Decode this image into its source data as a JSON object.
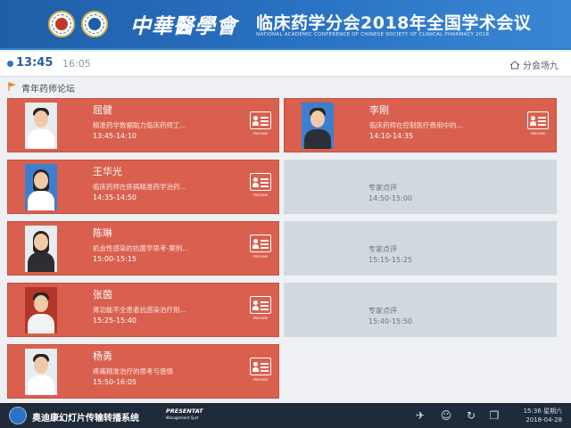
{
  "header": {
    "calligraphy": "中華醫學會",
    "title": "临床药学分会2018年全国学术会议",
    "subtitle": "NATIONAL ACADEMIC CONFERENCE OF CHINESE SOCIETY OF CLINICAL PHARMACY 2018"
  },
  "timebar": {
    "start": "13:45",
    "end": "16:05",
    "venue": "分会场九"
  },
  "section": {
    "title": "青年药师论坛"
  },
  "resume_label": "PRESUME",
  "sessions": [
    {
      "name": "屈健",
      "topic": "精准药学数据助力临床药师工...",
      "time": "13:45-14:10"
    },
    {
      "name": "李刚",
      "topic": "临床药师在控制医疗费用中的...",
      "time": "14:10-14:35"
    },
    {
      "name": "王华光",
      "topic": "临床药师在肝病精准药学治药...",
      "time": "14:35-14:50"
    },
    {
      "name": "陈琳",
      "topic": "机会性感染的抗菌学思考-案例...",
      "time": "15:00-15:15"
    },
    {
      "name": "张茵",
      "topic": "肾功能不全患者抗感染治疗用...",
      "time": "15:25-15:40"
    },
    {
      "name": "杨勇",
      "topic": "疼痛精准治疗的思考与感悟",
      "time": "15:50-16:05"
    }
  ],
  "expert": [
    {
      "label": "专家点评",
      "time": "14:50-15:00"
    },
    {
      "label": "专家点评",
      "time": "15:15-15:25"
    },
    {
      "label": "专家点评",
      "time": "15:40-15:50"
    }
  ],
  "taskbar": {
    "brand": "奥迪康幻灯片传输转播系统",
    "brand_en_1": "PRESENTAT",
    "brand_en_2": "Management Syst",
    "clock_time": "15:36 星期六",
    "clock_date": "2018-04-28"
  },
  "colors": {
    "header_blue": "#2a73c4",
    "speaker_card": "#d9604f",
    "empty_card": "#d2d8e0"
  }
}
